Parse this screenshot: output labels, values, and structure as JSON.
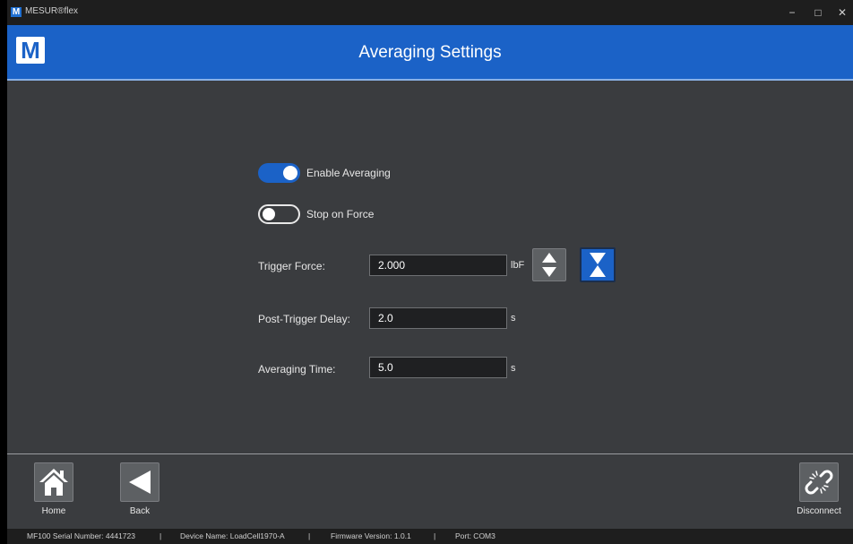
{
  "window": {
    "logo_letter": "M",
    "app_name": "MESUR®flex",
    "minimize": "−",
    "maximize": "□",
    "close": "✕"
  },
  "header": {
    "logo_letter": "M",
    "title": "Averaging Settings"
  },
  "toggles": {
    "enable_averaging": {
      "label": "Enable Averaging",
      "on": true
    },
    "stop_on_force": {
      "label": "Stop on Force",
      "on": false
    }
  },
  "fields": {
    "trigger_force": {
      "label": "Trigger Force:",
      "value": "2.000",
      "unit": "lbF"
    },
    "post_trigger_delay": {
      "label": "Post-Trigger Delay:",
      "value": "2.0",
      "unit": "s"
    },
    "averaging_time": {
      "label": "Averaging Time:",
      "value": "5.0",
      "unit": "s"
    }
  },
  "nav": {
    "home": "Home",
    "back": "Back",
    "disconnect": "Disconnect"
  },
  "status": {
    "serial": "MF100 Serial Number: 4441723",
    "sep": "|",
    "device": "Device Name: LoadCell1970-A",
    "firmware": "Firmware Version: 1.0.1",
    "port": "Port: COM3"
  },
  "colors": {
    "accent": "#1b62c7",
    "background": "#3a3c3f",
    "button_gray": "#5d6063"
  }
}
